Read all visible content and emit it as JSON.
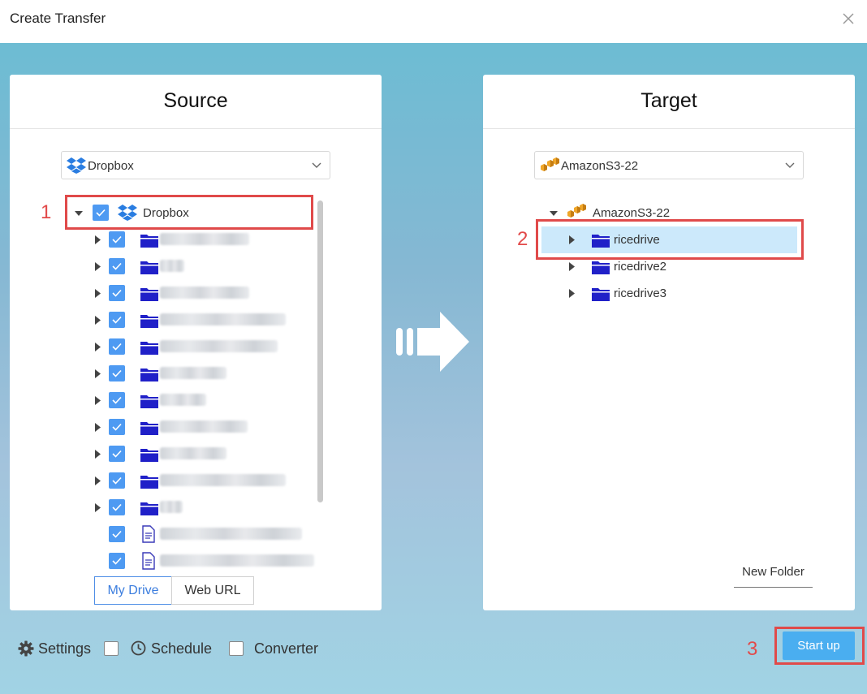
{
  "window": {
    "title": "Create Transfer"
  },
  "source": {
    "heading": "Source",
    "select_label": "Dropbox",
    "root_label": "Dropbox",
    "tabs": [
      {
        "label": "My Drive",
        "active": true
      },
      {
        "label": "Web URL",
        "active": false
      }
    ]
  },
  "target": {
    "heading": "Target",
    "select_label": "AmazonS3-22",
    "root_label": "AmazonS3-22",
    "folders": [
      {
        "label": "ricedrive",
        "selected": true
      },
      {
        "label": "ricedrive2",
        "selected": false
      },
      {
        "label": "ricedrive3",
        "selected": false
      }
    ],
    "new_folder_label": "New Folder"
  },
  "steps": {
    "one": "1",
    "two": "2",
    "three": "3"
  },
  "footer": {
    "settings_label": "Settings",
    "schedule_label": "Schedule",
    "converter_label": "Converter",
    "start_label": "Start up"
  },
  "colors": {
    "accent": "#4aaef0",
    "checkbox": "#4e9af2",
    "folder": "#2020c8",
    "highlight": "#e04a4a",
    "selected_row": "#cce9fb"
  }
}
